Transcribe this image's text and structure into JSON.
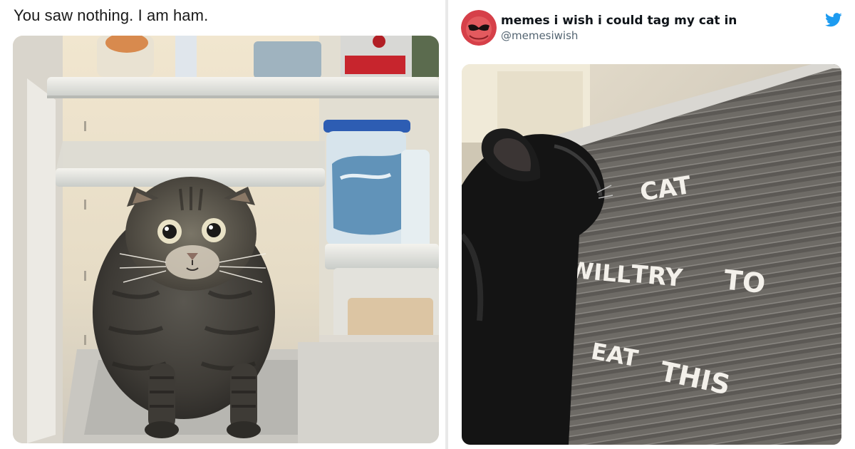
{
  "left_meme": {
    "caption": "You saw nothing. I am ham."
  },
  "tweet": {
    "account_name": "memes i wish i could tag my cat in",
    "handle": "@memesiwish",
    "logo_icon": "twitter-bird-icon",
    "brand_color": "#1d9bf0"
  },
  "letter_board": {
    "word_1": "CAT",
    "word_2": "WILL",
    "word_3": "TRY",
    "word_4": "TO",
    "word_5": "EAT",
    "word_6": "THIS"
  }
}
